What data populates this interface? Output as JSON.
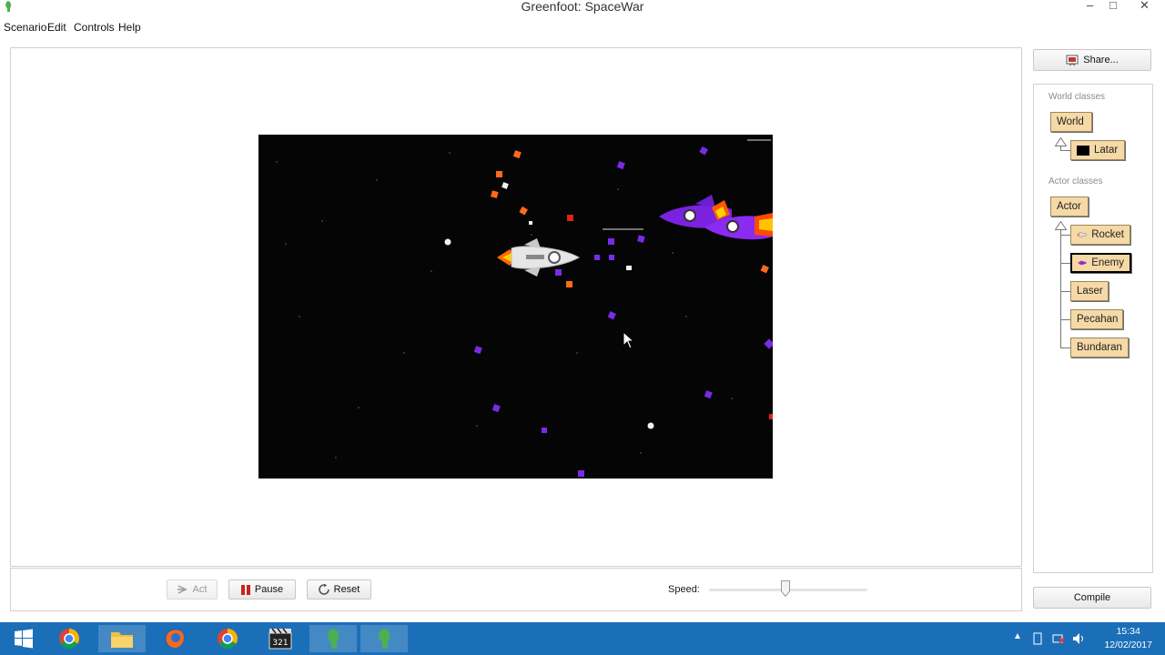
{
  "window": {
    "title": "Greenfoot: SpaceWar"
  },
  "menu": [
    "Scenario",
    "Edit",
    "Controls",
    "Help"
  ],
  "controls": {
    "act_label": "Act",
    "pause_label": "Pause",
    "reset_label": "Reset",
    "speed_label": "Speed:",
    "speed_fraction": 0.48
  },
  "classes": {
    "share_label": "Share...",
    "world_group_label": "World classes",
    "world_root": "World",
    "world_subclasses": [
      "Latar"
    ],
    "actor_group_label": "Actor classes",
    "actor_root": "Actor",
    "actor_subclasses": [
      "Rocket",
      "Enemy",
      "Laser",
      "Pecahan",
      "Bundaran"
    ],
    "selected": "Enemy",
    "compile_label": "Compile"
  },
  "taskbar": {
    "icons": [
      "start-icon",
      "chrome-icon",
      "file-explorer-icon",
      "firefox-icon",
      "chrome-alt-icon",
      "media-player-icon",
      "greenfoot-icon",
      "greenfoot-icon-2"
    ],
    "time": "15:34",
    "date": "12/02/2017"
  },
  "colors": {
    "taskbar": "#1b6fb8",
    "class_box": "#f5d9a6",
    "world_background": "#050505",
    "pause_icon": "#cc2222"
  }
}
